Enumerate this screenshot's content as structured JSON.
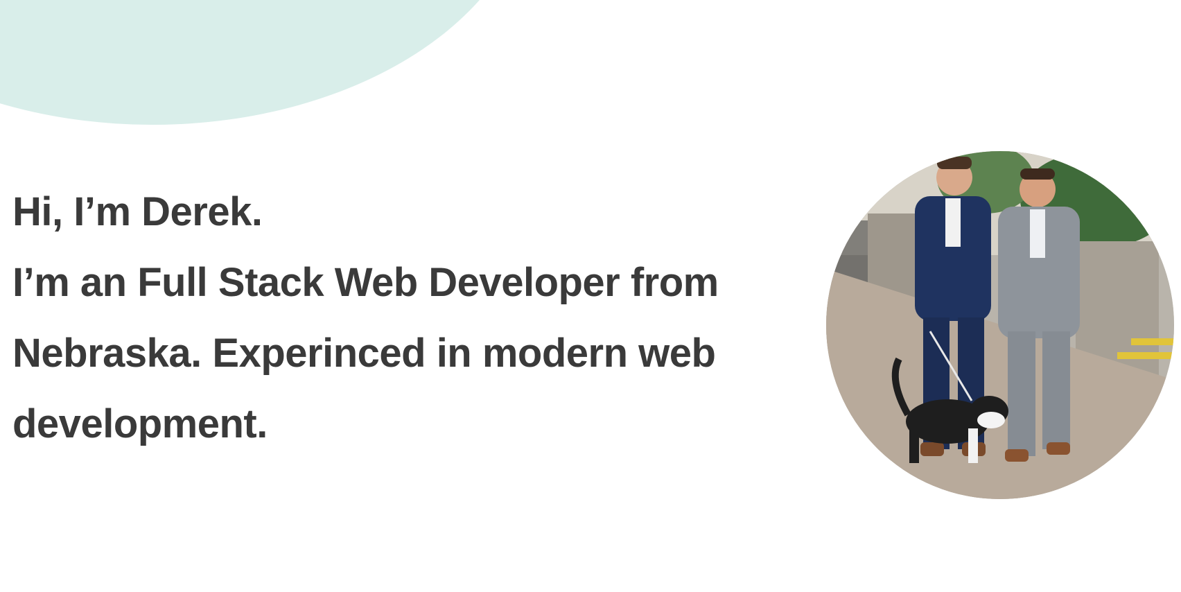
{
  "hero": {
    "greeting": "Hi, I’m Derek.",
    "bio": "I’m an Full Stack Web Developer from Nebraska. Experinced in modern web development."
  },
  "colors": {
    "accent_blob": "#d9eeea",
    "text": "#3a3a3a",
    "background": "#ffffff"
  }
}
